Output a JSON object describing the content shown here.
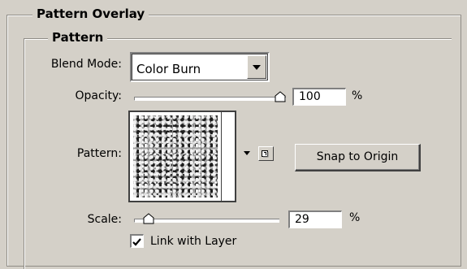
{
  "group_title": "Pattern Overlay",
  "subgroup_title": "Pattern",
  "blend_mode": {
    "label": "Blend Mode:",
    "value": "Color Burn"
  },
  "opacity": {
    "label": "Opacity:",
    "value": "100",
    "unit": "%",
    "level": 1.0
  },
  "pattern": {
    "label": "Pattern:",
    "icon": "pattern-swatch",
    "new_preset_icon": "new-preset-icon",
    "menu_icon": "chevron-down-icon"
  },
  "snap_button": "Snap to Origin",
  "scale": {
    "label": "Scale:",
    "value": "29",
    "unit": "%",
    "level": 0.1
  },
  "link_with_layer": {
    "label": "Link with Layer",
    "checked": true
  }
}
